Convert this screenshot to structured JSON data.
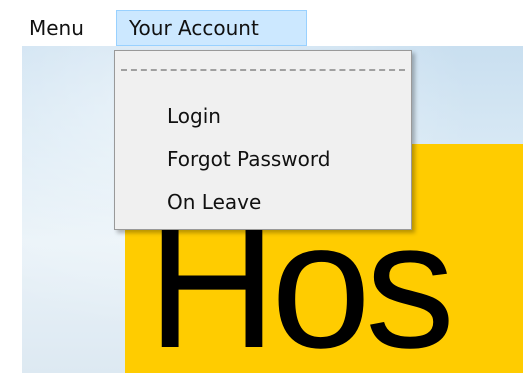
{
  "menubar": {
    "items": [
      {
        "label": "Menu"
      },
      {
        "label": "Your Account"
      }
    ]
  },
  "dropdown": {
    "items": [
      {
        "label": "Login"
      },
      {
        "label": "Forgot Password"
      },
      {
        "label": "On Leave"
      }
    ]
  },
  "background": {
    "logo_text": "Hos",
    "banner_color": "#ffcc00"
  },
  "colors": {
    "menu_highlight": "#cce8ff",
    "dropdown_bg": "#f0f0f0"
  }
}
